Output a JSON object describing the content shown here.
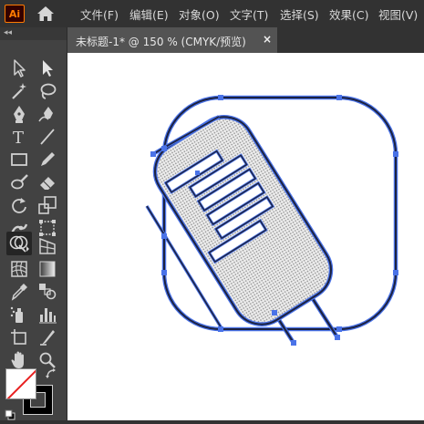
{
  "app": {
    "logo": "Ai"
  },
  "menu": [
    {
      "label": "文件(F)"
    },
    {
      "label": "编辑(E)"
    },
    {
      "label": "对象(O)"
    },
    {
      "label": "文字(T)"
    },
    {
      "label": "选择(S)"
    },
    {
      "label": "效果(C)"
    },
    {
      "label": "视图(V)"
    }
  ],
  "toolbar": {
    "collapse": "◂◂"
  },
  "document_tab": {
    "title": "未标题-1* @ 150 % (CMYK/预览)",
    "close": "×"
  },
  "tools": [
    {
      "icon": "selection-tool-icon"
    },
    {
      "icon": "direct-selection-tool-icon"
    },
    {
      "icon": "magic-wand-tool-icon"
    },
    {
      "icon": "lasso-tool-icon"
    },
    {
      "icon": "pen-tool-icon"
    },
    {
      "icon": "curvature-tool-icon"
    },
    {
      "icon": "type-tool-icon"
    },
    {
      "icon": "line-segment-tool-icon"
    },
    {
      "icon": "rectangle-tool-icon"
    },
    {
      "icon": "pencil-tool-icon"
    },
    {
      "icon": "blob-brush-tool-icon"
    },
    {
      "icon": "eraser-tool-icon"
    },
    {
      "icon": "rotate-tool-icon"
    },
    {
      "icon": "scale-tool-icon"
    },
    {
      "icon": "puppet-warp-tool-icon"
    },
    {
      "icon": "free-transform-tool-icon"
    },
    {
      "icon": "shape-builder-tool-icon"
    },
    {
      "icon": "perspective-grid-tool-icon"
    },
    {
      "icon": "mesh-tool-icon"
    },
    {
      "icon": "gradient-tool-icon"
    },
    {
      "icon": "eyedropper-tool-icon"
    },
    {
      "icon": "blend-tool-icon"
    },
    {
      "icon": "symbol-sprayer-tool-icon"
    },
    {
      "icon": "column-graph-tool-icon"
    },
    {
      "icon": "artboard-tool-icon"
    },
    {
      "icon": "slice-tool-icon"
    },
    {
      "icon": "hand-tool-icon"
    },
    {
      "icon": "zoom-tool-icon"
    }
  ],
  "selected_tool": "shape-builder-tool-icon",
  "colors": {
    "ui_background": "#323232",
    "toolbar": "#424242",
    "tab": "#535353",
    "canvas": "#ffffff",
    "path_stroke": "#1c2240",
    "selection_highlight": "#4a73e8",
    "anchor_points": "#4a73e8",
    "fill_pattern": "#c8c8c8"
  }
}
